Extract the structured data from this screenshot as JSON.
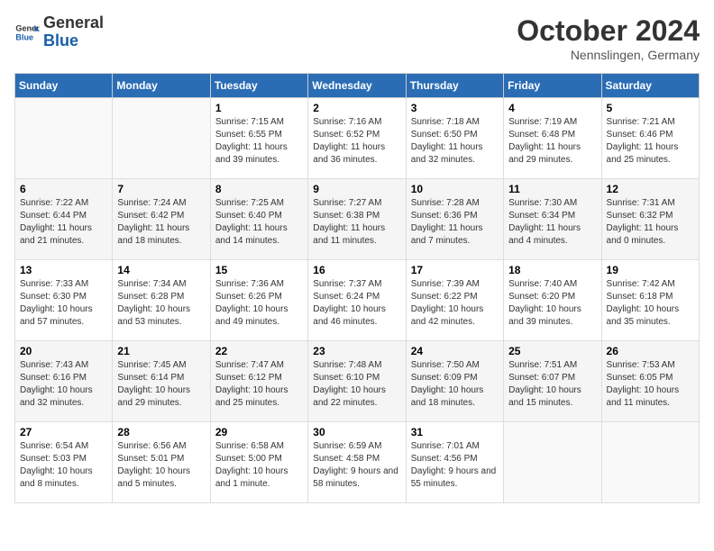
{
  "header": {
    "logo_text_general": "General",
    "logo_text_blue": "Blue",
    "month_title": "October 2024",
    "subtitle": "Nennslingen, Germany"
  },
  "weekdays": [
    "Sunday",
    "Monday",
    "Tuesday",
    "Wednesday",
    "Thursday",
    "Friday",
    "Saturday"
  ],
  "weeks": [
    [
      {
        "day": "",
        "sunrise": "",
        "sunset": "",
        "daylight": ""
      },
      {
        "day": "",
        "sunrise": "",
        "sunset": "",
        "daylight": ""
      },
      {
        "day": "1",
        "sunrise": "Sunrise: 7:15 AM",
        "sunset": "Sunset: 6:55 PM",
        "daylight": "Daylight: 11 hours and 39 minutes."
      },
      {
        "day": "2",
        "sunrise": "Sunrise: 7:16 AM",
        "sunset": "Sunset: 6:52 PM",
        "daylight": "Daylight: 11 hours and 36 minutes."
      },
      {
        "day": "3",
        "sunrise": "Sunrise: 7:18 AM",
        "sunset": "Sunset: 6:50 PM",
        "daylight": "Daylight: 11 hours and 32 minutes."
      },
      {
        "day": "4",
        "sunrise": "Sunrise: 7:19 AM",
        "sunset": "Sunset: 6:48 PM",
        "daylight": "Daylight: 11 hours and 29 minutes."
      },
      {
        "day": "5",
        "sunrise": "Sunrise: 7:21 AM",
        "sunset": "Sunset: 6:46 PM",
        "daylight": "Daylight: 11 hours and 25 minutes."
      }
    ],
    [
      {
        "day": "6",
        "sunrise": "Sunrise: 7:22 AM",
        "sunset": "Sunset: 6:44 PM",
        "daylight": "Daylight: 11 hours and 21 minutes."
      },
      {
        "day": "7",
        "sunrise": "Sunrise: 7:24 AM",
        "sunset": "Sunset: 6:42 PM",
        "daylight": "Daylight: 11 hours and 18 minutes."
      },
      {
        "day": "8",
        "sunrise": "Sunrise: 7:25 AM",
        "sunset": "Sunset: 6:40 PM",
        "daylight": "Daylight: 11 hours and 14 minutes."
      },
      {
        "day": "9",
        "sunrise": "Sunrise: 7:27 AM",
        "sunset": "Sunset: 6:38 PM",
        "daylight": "Daylight: 11 hours and 11 minutes."
      },
      {
        "day": "10",
        "sunrise": "Sunrise: 7:28 AM",
        "sunset": "Sunset: 6:36 PM",
        "daylight": "Daylight: 11 hours and 7 minutes."
      },
      {
        "day": "11",
        "sunrise": "Sunrise: 7:30 AM",
        "sunset": "Sunset: 6:34 PM",
        "daylight": "Daylight: 11 hours and 4 minutes."
      },
      {
        "day": "12",
        "sunrise": "Sunrise: 7:31 AM",
        "sunset": "Sunset: 6:32 PM",
        "daylight": "Daylight: 11 hours and 0 minutes."
      }
    ],
    [
      {
        "day": "13",
        "sunrise": "Sunrise: 7:33 AM",
        "sunset": "Sunset: 6:30 PM",
        "daylight": "Daylight: 10 hours and 57 minutes."
      },
      {
        "day": "14",
        "sunrise": "Sunrise: 7:34 AM",
        "sunset": "Sunset: 6:28 PM",
        "daylight": "Daylight: 10 hours and 53 minutes."
      },
      {
        "day": "15",
        "sunrise": "Sunrise: 7:36 AM",
        "sunset": "Sunset: 6:26 PM",
        "daylight": "Daylight: 10 hours and 49 minutes."
      },
      {
        "day": "16",
        "sunrise": "Sunrise: 7:37 AM",
        "sunset": "Sunset: 6:24 PM",
        "daylight": "Daylight: 10 hours and 46 minutes."
      },
      {
        "day": "17",
        "sunrise": "Sunrise: 7:39 AM",
        "sunset": "Sunset: 6:22 PM",
        "daylight": "Daylight: 10 hours and 42 minutes."
      },
      {
        "day": "18",
        "sunrise": "Sunrise: 7:40 AM",
        "sunset": "Sunset: 6:20 PM",
        "daylight": "Daylight: 10 hours and 39 minutes."
      },
      {
        "day": "19",
        "sunrise": "Sunrise: 7:42 AM",
        "sunset": "Sunset: 6:18 PM",
        "daylight": "Daylight: 10 hours and 35 minutes."
      }
    ],
    [
      {
        "day": "20",
        "sunrise": "Sunrise: 7:43 AM",
        "sunset": "Sunset: 6:16 PM",
        "daylight": "Daylight: 10 hours and 32 minutes."
      },
      {
        "day": "21",
        "sunrise": "Sunrise: 7:45 AM",
        "sunset": "Sunset: 6:14 PM",
        "daylight": "Daylight: 10 hours and 29 minutes."
      },
      {
        "day": "22",
        "sunrise": "Sunrise: 7:47 AM",
        "sunset": "Sunset: 6:12 PM",
        "daylight": "Daylight: 10 hours and 25 minutes."
      },
      {
        "day": "23",
        "sunrise": "Sunrise: 7:48 AM",
        "sunset": "Sunset: 6:10 PM",
        "daylight": "Daylight: 10 hours and 22 minutes."
      },
      {
        "day": "24",
        "sunrise": "Sunrise: 7:50 AM",
        "sunset": "Sunset: 6:09 PM",
        "daylight": "Daylight: 10 hours and 18 minutes."
      },
      {
        "day": "25",
        "sunrise": "Sunrise: 7:51 AM",
        "sunset": "Sunset: 6:07 PM",
        "daylight": "Daylight: 10 hours and 15 minutes."
      },
      {
        "day": "26",
        "sunrise": "Sunrise: 7:53 AM",
        "sunset": "Sunset: 6:05 PM",
        "daylight": "Daylight: 10 hours and 11 minutes."
      }
    ],
    [
      {
        "day": "27",
        "sunrise": "Sunrise: 6:54 AM",
        "sunset": "Sunset: 5:03 PM",
        "daylight": "Daylight: 10 hours and 8 minutes."
      },
      {
        "day": "28",
        "sunrise": "Sunrise: 6:56 AM",
        "sunset": "Sunset: 5:01 PM",
        "daylight": "Daylight: 10 hours and 5 minutes."
      },
      {
        "day": "29",
        "sunrise": "Sunrise: 6:58 AM",
        "sunset": "Sunset: 5:00 PM",
        "daylight": "Daylight: 10 hours and 1 minute."
      },
      {
        "day": "30",
        "sunrise": "Sunrise: 6:59 AM",
        "sunset": "Sunset: 4:58 PM",
        "daylight": "Daylight: 9 hours and 58 minutes."
      },
      {
        "day": "31",
        "sunrise": "Sunrise: 7:01 AM",
        "sunset": "Sunset: 4:56 PM",
        "daylight": "Daylight: 9 hours and 55 minutes."
      },
      {
        "day": "",
        "sunrise": "",
        "sunset": "",
        "daylight": ""
      },
      {
        "day": "",
        "sunrise": "",
        "sunset": "",
        "daylight": ""
      }
    ]
  ]
}
